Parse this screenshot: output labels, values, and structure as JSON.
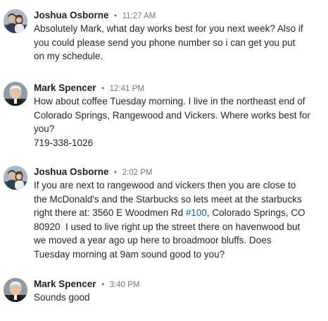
{
  "messages": [
    {
      "sender": "Joshua Osborne",
      "separator": "•",
      "time": "11:27 AM",
      "avatar_icon": "couple-photo-avatar",
      "lines": [
        "Absolutely Mark, what day works best for you next week? Also if",
        "you could please send you phone number so i can get you put",
        "on my schedule."
      ]
    },
    {
      "sender": "Mark Spencer",
      "separator": "•",
      "time": "12:41 PM",
      "avatar_icon": "man-photo-avatar",
      "lines": [
        "How about coffee Tuesday morning. I live in the northeast end of",
        "Colorado Springs, Rangewood and Vickers. Where works best for",
        "you?",
        "719-338-1026"
      ]
    },
    {
      "sender": "Joshua Osborne",
      "separator": "•",
      "time": "2:02 PM",
      "avatar_icon": "couple-photo-avatar",
      "lines": [
        "If you are next to rangewood and vickers then you are close to",
        "the McDonald's and the Starbucks so lets meet at the starbucks",
        "right there at: 3560 E Woodmen Rd ",
        "#100",
        ", Colorado Springs, CO",
        "80920  I used to live right up the street there on havenwood but",
        "we moved a year ago up here to broadmoor bluffs. Does",
        "Tuesday morning at 9am sound good to you?"
      ]
    },
    {
      "sender": "Mark Spencer",
      "separator": "•",
      "time": "3:40 PM",
      "avatar_icon": "man-photo-avatar",
      "lines": [
        "Sounds good"
      ]
    }
  ],
  "colors": {
    "link": "#0a66c2",
    "name": "#1f1f1f",
    "meta": "#777777",
    "text": "#262626"
  }
}
